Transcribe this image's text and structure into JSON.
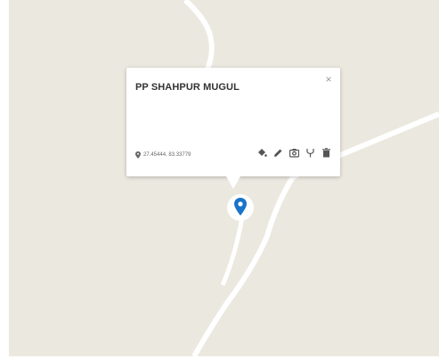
{
  "popup": {
    "title": "PP SHAHPUR MUGUL",
    "close_label": "×",
    "coordinates": "27.45444, 83.33779"
  },
  "toolbar": {
    "icons": [
      "paint-bucket-icon",
      "pencil-icon",
      "camera-icon",
      "fork-icon",
      "trash-icon"
    ]
  },
  "colors": {
    "map_background": "#ebe8df",
    "road": "#ffffff",
    "marker": "#1a73c8"
  }
}
